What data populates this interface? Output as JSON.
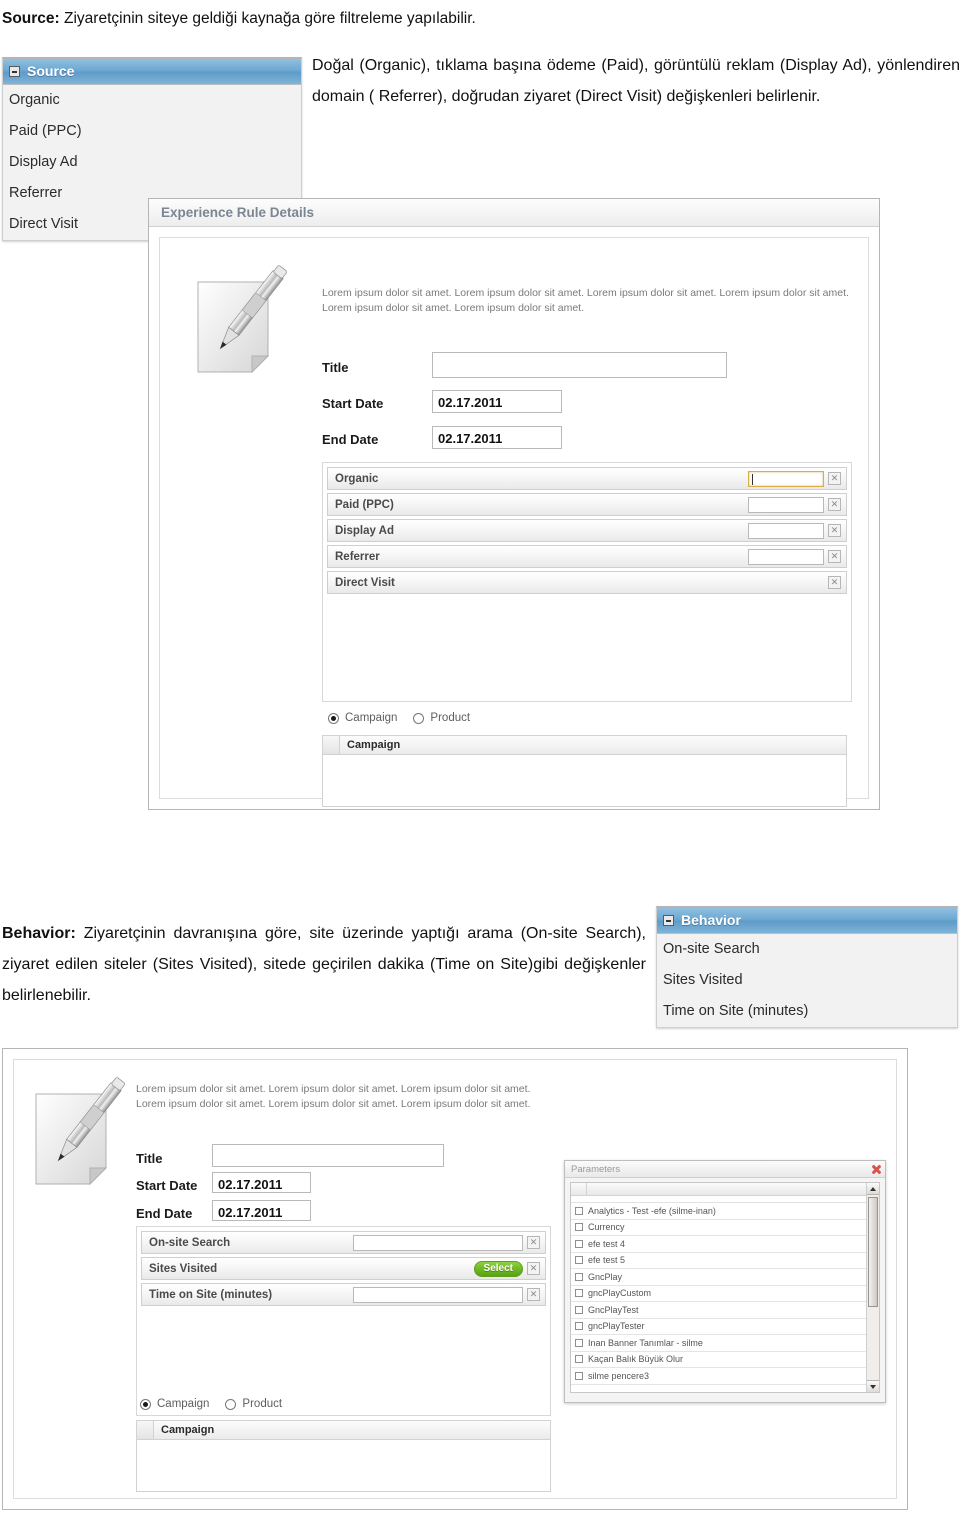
{
  "document": {
    "source_heading_bold": "Source:",
    "source_heading_rest": " Ziyaretçinin siteye geldiği kaynağa göre filtreleme yapılabilir.",
    "source_paragraph": "Doğal (Organic), tıklama başına ödeme (Paid), görüntülü reklam (Display Ad), yönlendiren domain ( Referrer), doğrudan ziyaret (Direct Visit) değişkenleri belirlenir.",
    "behavior_heading_bold": "Behavior:",
    "behavior_paragraph_rest": " Ziyaretçinin davranışına göre, site üzerinde yaptığı arama (On-site Search), ziyaret edilen siteler (Sites Visited), sitede geçirilen dakika (Time on Site)gibi değişkenler belirlenebilir."
  },
  "source_tree": {
    "header": "Source",
    "toggle_icon": "minus-box-icon",
    "items": [
      "Organic",
      "Paid (PPC)",
      "Display Ad",
      "Referrer",
      "Direct Visit"
    ]
  },
  "behavior_tree": {
    "header": "Behavior",
    "toggle_icon": "minus-box-icon",
    "items": [
      "On-site Search",
      "Sites Visited",
      "Time on Site (minutes)"
    ]
  },
  "source_form": {
    "panel_title": "Experience Rule Details",
    "note_icon": "pencil-note-icon",
    "lorem": "Lorem ipsum dolor sit amet. Lorem ipsum dolor sit amet. Lorem ipsum dolor sit amet. Lorem ipsum dolor sit amet. Lorem ipsum dolor sit amet. Lorem ipsum dolor sit amet.",
    "fields": [
      {
        "label": "Title",
        "value": ""
      },
      {
        "label": "Start Date",
        "value": "02.17.2011"
      },
      {
        "label": "End Date",
        "value": "02.17.2011"
      }
    ],
    "criteria": [
      {
        "name": "Organic",
        "control": "input",
        "focused": true,
        "remove_icon": "remove-x-icon"
      },
      {
        "name": "Paid (PPC)",
        "control": "input",
        "focused": false,
        "remove_icon": "remove-x-icon"
      },
      {
        "name": "Display Ad",
        "control": "input",
        "focused": false,
        "remove_icon": "remove-x-icon"
      },
      {
        "name": "Referrer",
        "control": "input",
        "focused": false,
        "remove_icon": "remove-x-icon"
      },
      {
        "name": "Direct Visit",
        "control": "none",
        "focused": false,
        "remove_icon": "remove-x-icon"
      }
    ],
    "radios": [
      {
        "label": "Campaign",
        "selected": true
      },
      {
        "label": "Product",
        "selected": false
      }
    ],
    "grid_column": "Campaign"
  },
  "behavior_form": {
    "note_icon": "pencil-note-icon",
    "lorem": "Lorem ipsum dolor sit amet. Lorem ipsum dolor sit amet. Lorem ipsum dolor sit amet. Lorem ipsum dolor sit amet. Lorem ipsum dolor sit amet. Lorem ipsum dolor sit amet.",
    "fields": [
      {
        "label": "Title",
        "value": ""
      },
      {
        "label": "Start Date",
        "value": "02.17.2011"
      },
      {
        "label": "End Date",
        "value": "02.17.2011"
      }
    ],
    "criteria": [
      {
        "name": "On-site Search",
        "control": "input",
        "focused": false,
        "remove_icon": "remove-x-icon"
      },
      {
        "name": "Sites Visited",
        "control": "button",
        "button_label": "Select",
        "remove_icon": "remove-x-icon"
      },
      {
        "name": "Time on Site (minutes)",
        "control": "input",
        "focused": false,
        "remove_icon": "remove-x-icon"
      }
    ],
    "radios": [
      {
        "label": "Campaign",
        "selected": true
      },
      {
        "label": "Product",
        "selected": false
      }
    ],
    "grid_column": "Campaign"
  },
  "parameters_window": {
    "title": "Parameters",
    "close_icon": "close-x-icon",
    "scroll_up_icon": "arrow-up-icon",
    "scroll_down_icon": "arrow-down-icon",
    "items": [
      "Analytics - Test -efe (silme-inan)",
      "Currency",
      "efe test 4",
      "efe test 5",
      "GncPlay",
      "gncPlayCustom",
      "GncPlayTest",
      "gncPlayTester",
      "Inan Banner Tanımlar - silme",
      "Kaçan Balık Büyük Olur",
      "silme pencere3"
    ]
  },
  "colors": {
    "tree_header_blue": "#6aa5cf",
    "panel_title_gray": "#7a8692",
    "focus_orange": "#d8ad4a",
    "select_green": "#6cb523",
    "close_red": "#d9534f"
  }
}
